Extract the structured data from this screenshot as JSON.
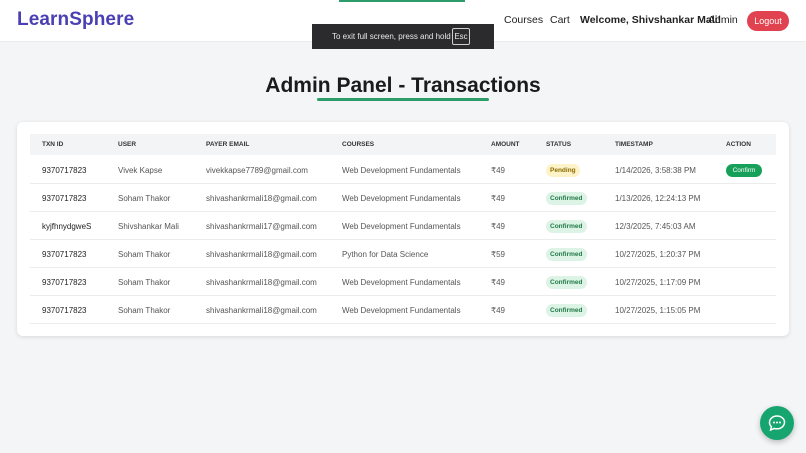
{
  "brand": "LearnSphere",
  "nav": {
    "courses": "Courses",
    "cart": "Cart",
    "welcome": "Welcome, Shivshankar Mali!",
    "admin": "Admin",
    "logout": "Logout"
  },
  "fullscreen_toast": {
    "message": "To exit full screen, press and hold",
    "key": "Esc"
  },
  "page_title": "Admin Panel - Transactions",
  "table": {
    "headers": {
      "txn_id": "TXN ID",
      "user": "USER",
      "payer_email": "PAYER EMAIL",
      "courses": "COURSES",
      "amount": "AMOUNT",
      "status": "STATUS",
      "timestamp": "TIMESTAMP",
      "action": "ACTION"
    },
    "rows": [
      {
        "txn_id": "9370717823",
        "user": "Vivek Kapse",
        "email": "vivekkapse7789@gmail.com",
        "course": "Web Development Fundamentals",
        "amount": "₹49",
        "status": "Pending",
        "timestamp": "1/14/2026, 3:58:38 PM",
        "action": "Confirm"
      },
      {
        "txn_id": "9370717823",
        "user": "Soham Thakor",
        "email": "shivashankrmali18@gmail.com",
        "course": "Web Development Fundamentals",
        "amount": "₹49",
        "status": "Confirmed",
        "timestamp": "1/13/2026, 12:24:13 PM",
        "action": ""
      },
      {
        "txn_id": "kyjfhnydgweS",
        "user": "Shivshankar Mali",
        "email": "shivashankrmali17@gmail.com",
        "course": "Web Development Fundamentals",
        "amount": "₹49",
        "status": "Confirmed",
        "timestamp": "12/3/2025, 7:45:03 AM",
        "action": ""
      },
      {
        "txn_id": "9370717823",
        "user": "Soham Thakor",
        "email": "shivashankrmali18@gmail.com",
        "course": "Python for Data Science",
        "amount": "₹59",
        "status": "Confirmed",
        "timestamp": "10/27/2025, 1:20:37 PM",
        "action": ""
      },
      {
        "txn_id": "9370717823",
        "user": "Soham Thakor",
        "email": "shivashankrmali18@gmail.com",
        "course": "Web Development Fundamentals",
        "amount": "₹49",
        "status": "Confirmed",
        "timestamp": "10/27/2025, 1:17:09 PM",
        "action": ""
      },
      {
        "txn_id": "9370717823",
        "user": "Soham Thakor",
        "email": "shivashankrmali18@gmail.com",
        "course": "Web Development Fundamentals",
        "amount": "₹49",
        "status": "Confirmed",
        "timestamp": "10/27/2025, 1:15:05 PM",
        "action": ""
      }
    ]
  },
  "colors": {
    "brand": "#4a3fb3",
    "accent_green": "#2d9c6a",
    "logout_red": "#e0424f",
    "pending_bg": "#fdf3c8",
    "confirmed_bg": "#ddf3e6"
  },
  "icons": {
    "chat": "chat-bubble-icon"
  }
}
